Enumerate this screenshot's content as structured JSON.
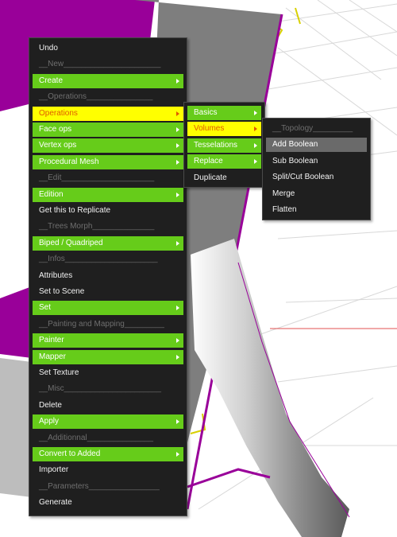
{
  "colors": {
    "menu_bg": "#1f1f1f",
    "green_item": "#66cc1a",
    "yellow_item": "#ffff00",
    "yellow_text": "#e05a00",
    "highlight_item": "#6a6a6a",
    "separator_text": "#6e6e6e",
    "model_purple": "#990099",
    "model_gray": "#bdbdbd"
  },
  "main_menu": {
    "items": [
      {
        "label": "Undo",
        "style": "normal"
      },
      {
        "label": "__New______________________",
        "style": "separator"
      },
      {
        "label": "Create",
        "style": "green",
        "submenu": true
      },
      {
        "label": "__Operations_______________",
        "style": "separator"
      },
      {
        "label": "Operations",
        "style": "yellow",
        "submenu": true
      },
      {
        "label": "Face ops",
        "style": "green",
        "submenu": true
      },
      {
        "label": "Vertex ops",
        "style": "green",
        "submenu": true
      },
      {
        "label": "Procedural Mesh",
        "style": "green",
        "submenu": true
      },
      {
        "label": "__Edit_____________________",
        "style": "separator"
      },
      {
        "label": "Edition",
        "style": "green",
        "submenu": true
      },
      {
        "label": "Get this to Replicate",
        "style": "normal"
      },
      {
        "label": "__Trees Morph______________",
        "style": "separator"
      },
      {
        "label": "Biped / Quadriped",
        "style": "green",
        "submenu": true
      },
      {
        "label": "__Infos_____________________",
        "style": "separator"
      },
      {
        "label": "Attributes",
        "style": "normal"
      },
      {
        "label": "Set to Scene",
        "style": "normal"
      },
      {
        "label": "Set",
        "style": "green",
        "submenu": true
      },
      {
        "label": "__Painting and Mapping_________",
        "style": "separator"
      },
      {
        "label": "Painter",
        "style": "green",
        "submenu": true
      },
      {
        "label": "Mapper",
        "style": "green",
        "submenu": true
      },
      {
        "label": "Set Texture",
        "style": "normal"
      },
      {
        "label": "__Misc______________________",
        "style": "separator"
      },
      {
        "label": "Delete",
        "style": "normal"
      },
      {
        "label": "Apply",
        "style": "green",
        "submenu": true
      },
      {
        "label": "__Additionnal_______________",
        "style": "separator"
      },
      {
        "label": "Convert to Added",
        "style": "green",
        "submenu": true
      },
      {
        "label": "Importer",
        "style": "normal"
      },
      {
        "label": "__Parameters________________",
        "style": "separator"
      },
      {
        "label": "Generate",
        "style": "normal"
      }
    ]
  },
  "operations_menu": {
    "items": [
      {
        "label": "Basics",
        "style": "green",
        "submenu": true
      },
      {
        "label": "Volumes",
        "style": "yellow",
        "submenu": true
      },
      {
        "label": "Tesselations",
        "style": "green",
        "submenu": true
      },
      {
        "label": "Replace",
        "style": "green",
        "submenu": true
      },
      {
        "label": "Duplicate",
        "style": "normal"
      }
    ]
  },
  "volumes_menu": {
    "items": [
      {
        "label": "__Topology_________",
        "style": "separator"
      },
      {
        "label": "Add Boolean",
        "style": "highlight"
      },
      {
        "label": "Sub Boolean",
        "style": "normal"
      },
      {
        "label": "Split/Cut Boolean",
        "style": "normal"
      },
      {
        "label": "Merge",
        "style": "normal"
      },
      {
        "label": "Flatten",
        "style": "normal"
      }
    ]
  }
}
